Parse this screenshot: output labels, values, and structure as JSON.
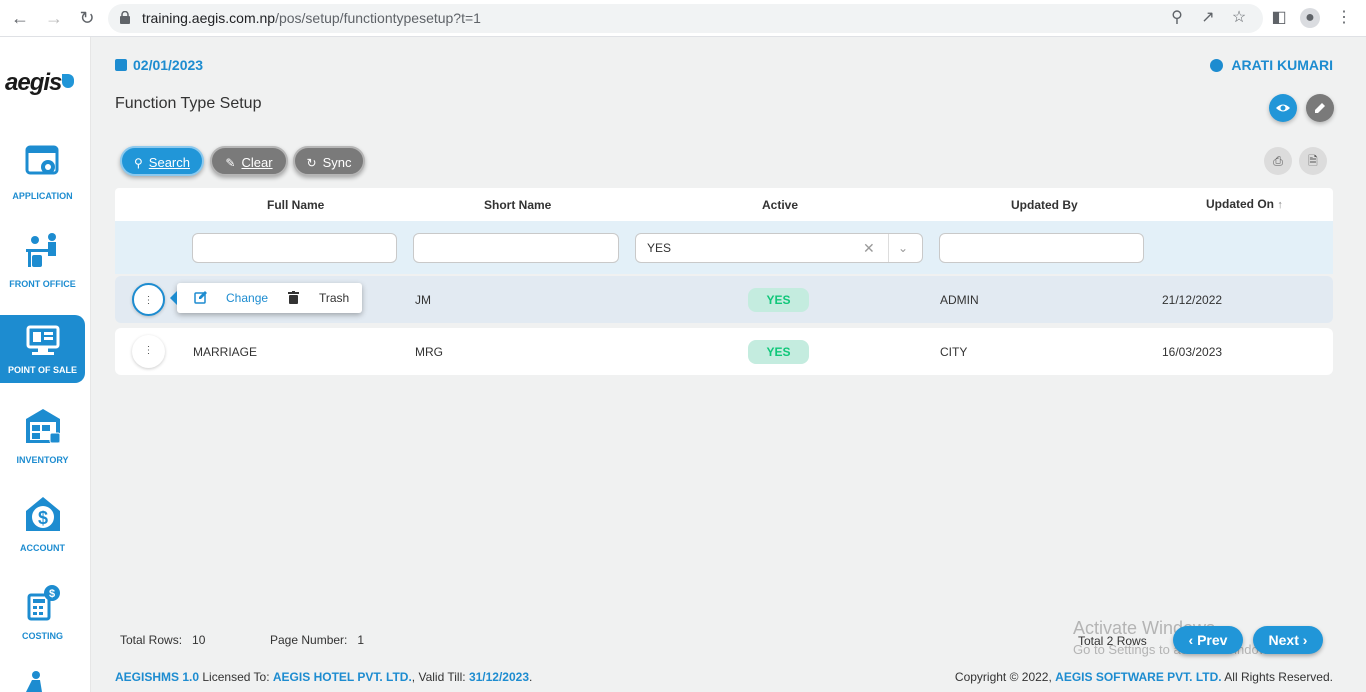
{
  "browser": {
    "url_host": "training.aegis.com.np",
    "url_path": "/pos/setup/functiontypesetup?t=1"
  },
  "sidebar": {
    "logo": "aegis",
    "items": [
      {
        "label": "APPLICATION",
        "icon": "application-icon"
      },
      {
        "label": "FRONT OFFICE",
        "icon": "front-office-icon"
      },
      {
        "label": "POINT OF SALE",
        "icon": "point-of-sale-icon",
        "active": true
      },
      {
        "label": "INVENTORY",
        "icon": "inventory-icon"
      },
      {
        "label": "ACCOUNT",
        "icon": "account-icon"
      },
      {
        "label": "COSTING",
        "icon": "costing-icon"
      }
    ]
  },
  "header": {
    "date": "02/01/2023",
    "user": "ARATI KUMARI",
    "title": "Function Type Setup"
  },
  "toolbar": {
    "search": "Search",
    "clear": "Clear",
    "sync": "Sync"
  },
  "table": {
    "columns": [
      "Full Name",
      "Short Name",
      "Active",
      "Updated By",
      "Updated On"
    ],
    "sort_indicator": "↑",
    "filters": {
      "full_name": "",
      "short_name": "",
      "active": "YES",
      "updated_by": ""
    },
    "rows": [
      {
        "full_name": "",
        "short_name": "JM",
        "active": "YES",
        "updated_by": "ADMIN",
        "updated_on": "21/12/2022"
      },
      {
        "full_name": "MARRIAGE",
        "short_name": "MRG",
        "active": "YES",
        "updated_by": "CITY",
        "updated_on": "16/03/2023"
      }
    ]
  },
  "row_menu": {
    "change": "Change",
    "trash": "Trash"
  },
  "footer": {
    "total_rows_label": "Total Rows:",
    "total_rows_value": "10",
    "page_number_label": "Page Number:",
    "page_number_value": "1",
    "total_rows_summary": "Total 2 Rows",
    "prev": "Prev",
    "next": "Next",
    "product": "AEGISHMS 1.0",
    "licensed_to_label": "Licensed To:",
    "licensee": "AEGIS HOTEL PVT. LTD.",
    "valid_till_label": ", Valid Till:",
    "valid_till": "31/12/2023",
    "copyright_prefix": "Copyright © 2022,",
    "company": "AEGIS SOFTWARE PVT. LTD.",
    "rights": "All Rights Reserved."
  },
  "watermark": {
    "line1": "Activate Windows",
    "line2": "Go to Settings to activate Windows."
  },
  "colors": {
    "accent": "#1d8cd0",
    "active_badge_bg": "#c4ecdf",
    "active_badge_text": "#10c77a",
    "pill_gray": "#7a7a7a"
  }
}
